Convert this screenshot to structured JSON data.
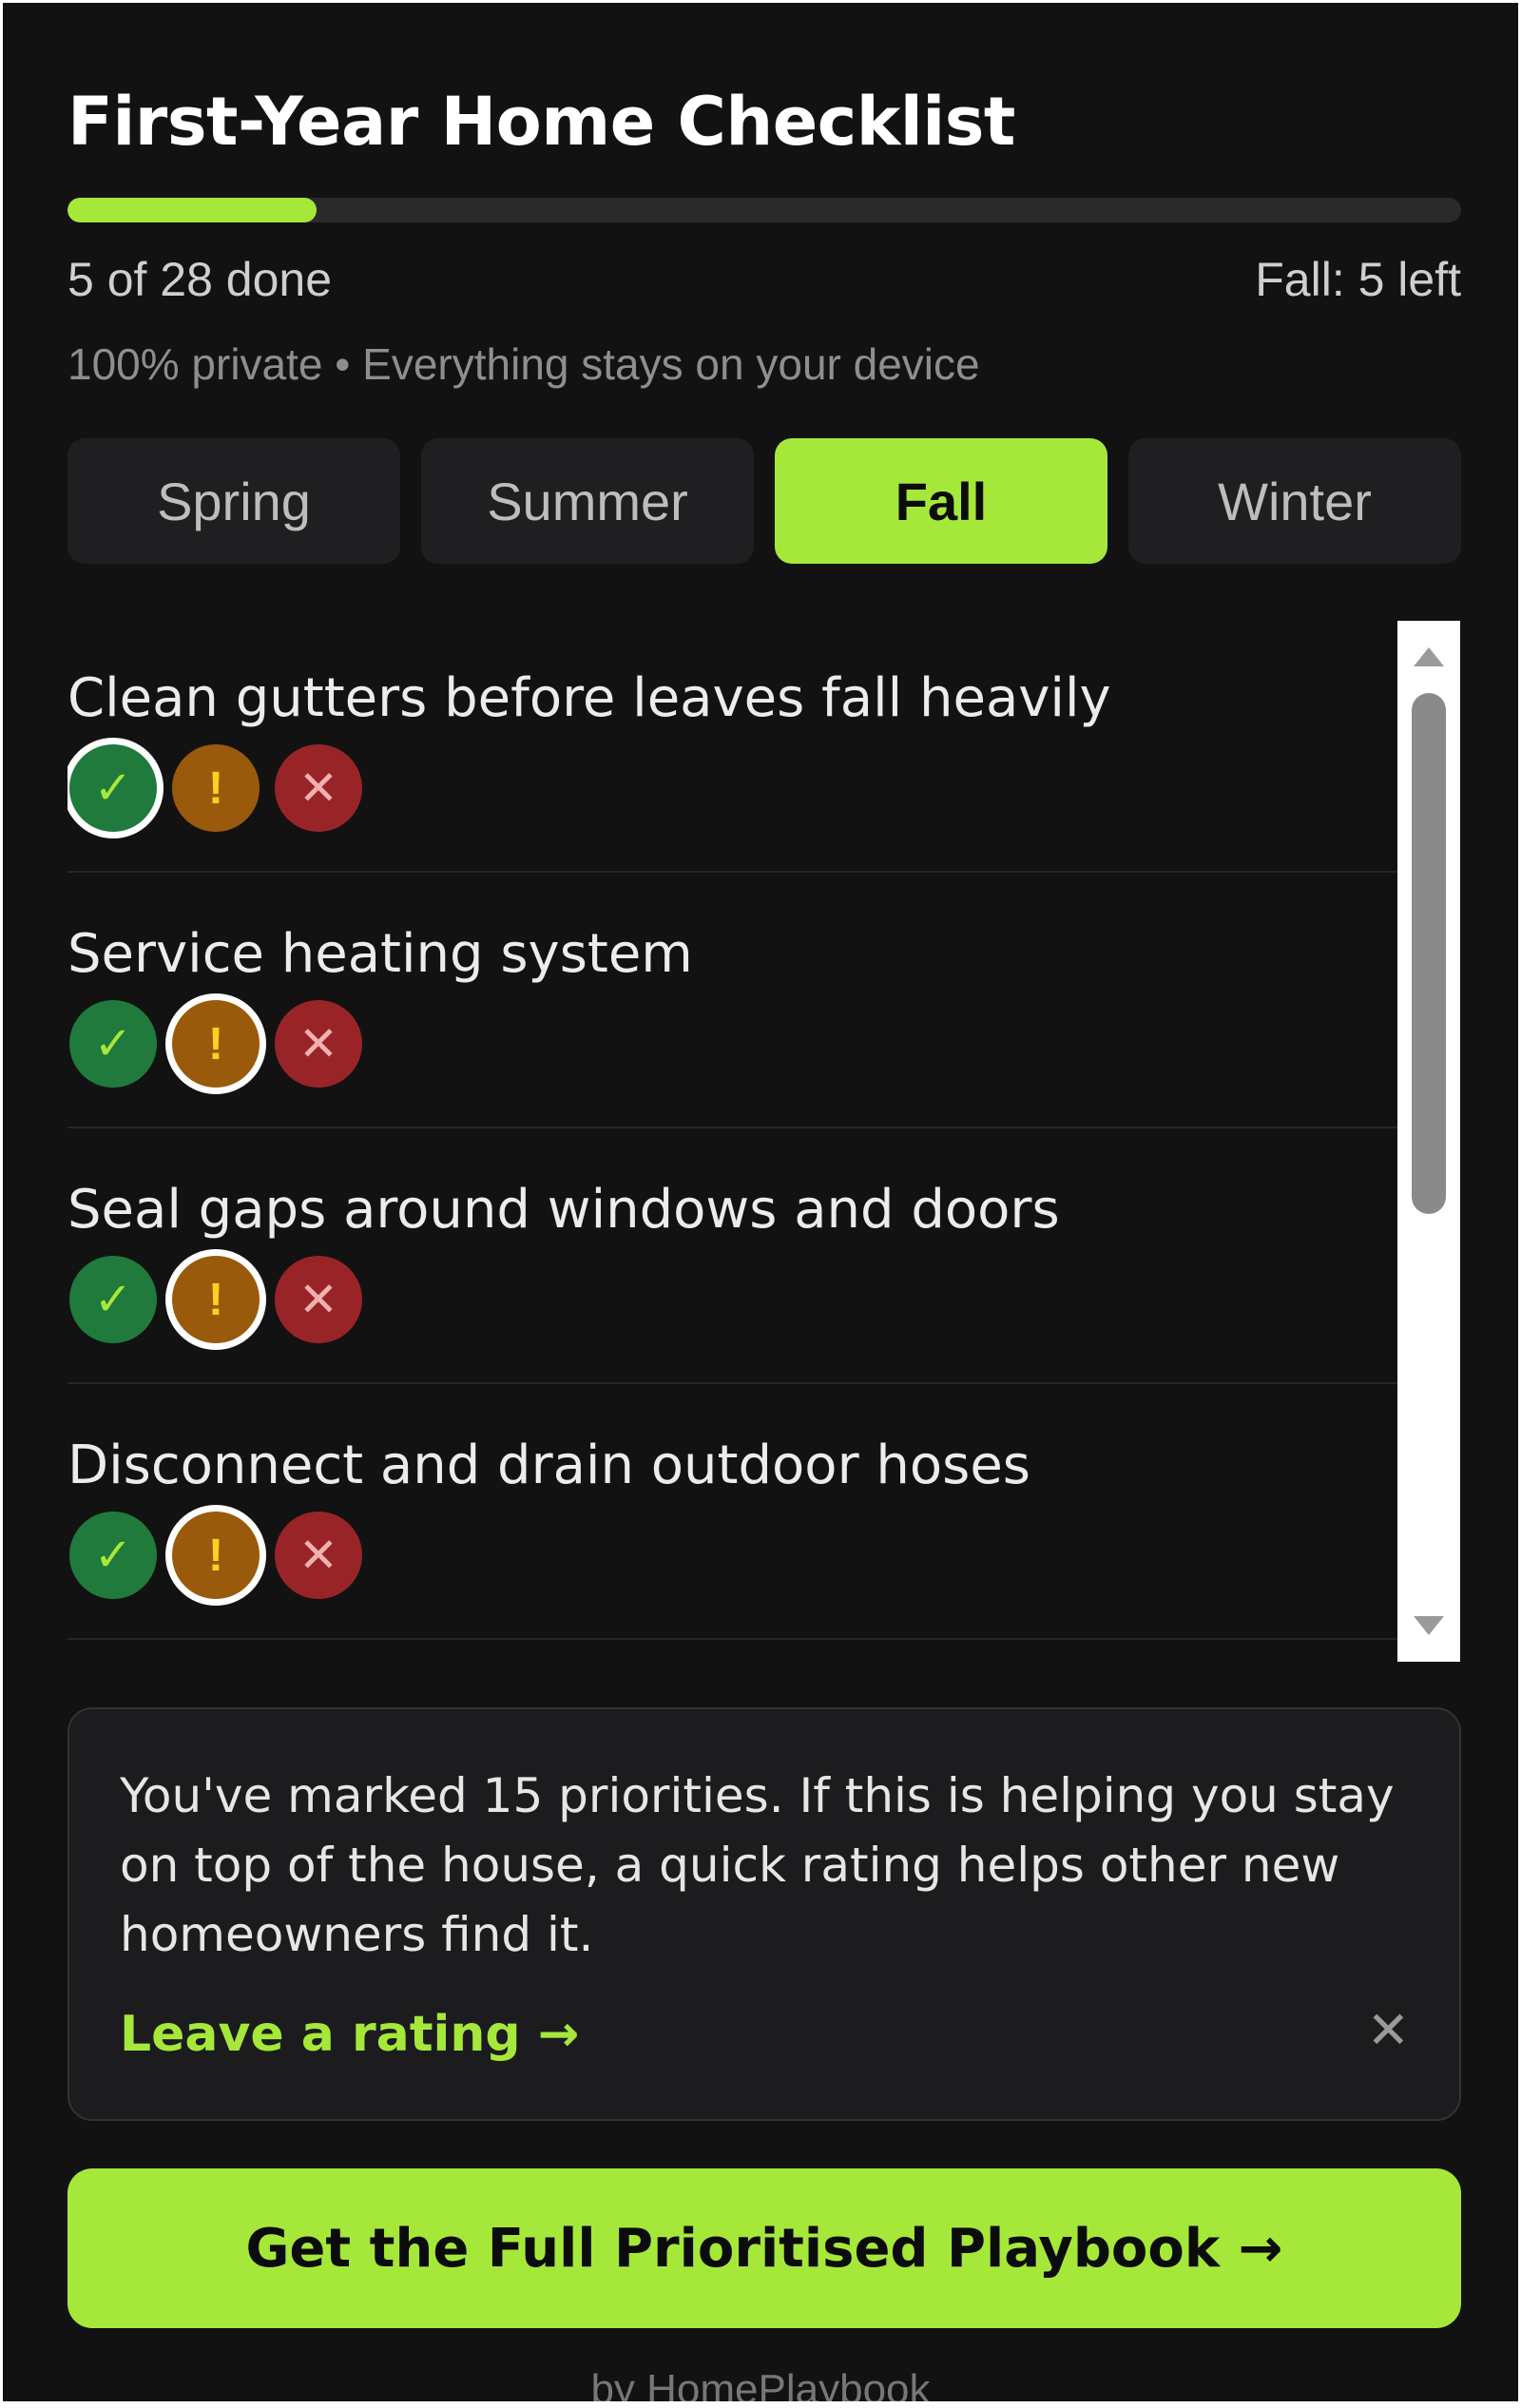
{
  "header": {
    "title": "First-Year Home Checklist",
    "progress": {
      "done": 5,
      "total": 28,
      "fraction": 0.179
    },
    "progress_text": "5 of 28 done",
    "season_remaining_text": "Fall: 5 left",
    "privacy_text": "100% private • Everything stays on your device"
  },
  "tabs": [
    {
      "label": "Spring",
      "active": false
    },
    {
      "label": "Summer",
      "active": false
    },
    {
      "label": "Fall",
      "active": true
    },
    {
      "label": "Winter",
      "active": false
    }
  ],
  "items": [
    {
      "title": "Clean gutters before leaves fall heavily",
      "selected": "done"
    },
    {
      "title": "Service heating system",
      "selected": "priority"
    },
    {
      "title": "Seal gaps around windows and doors",
      "selected": "priority"
    },
    {
      "title": "Disconnect and drain outdoor hoses",
      "selected": "priority"
    }
  ],
  "buttons": {
    "done_symbol": "✓",
    "priority_symbol": "!",
    "skip_symbol": "✕"
  },
  "rating_card": {
    "text": "You've marked 15 priorities. If this is helping you stay on top of the house, a quick rating helps other new homeowners find it.",
    "link_label": "Leave a rating →",
    "close_symbol": "✕"
  },
  "cta": {
    "label": "Get the Full Prioritised Playbook →"
  },
  "footer": {
    "text": "by HomePlaybook"
  },
  "colors": {
    "accent": "#a6e83a",
    "background": "#121213",
    "done": "#1f7a3c",
    "priority": "#9a5a0c",
    "skip": "#992428"
  },
  "icons": {
    "done": "check-icon",
    "priority": "exclamation-icon",
    "skip": "x-icon",
    "close": "close-icon"
  }
}
